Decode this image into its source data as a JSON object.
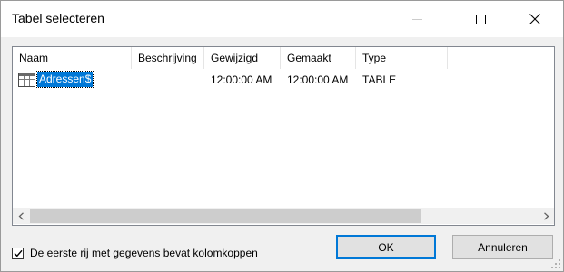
{
  "window": {
    "title": "Tabel selecteren"
  },
  "titlebar_controls": {
    "minimize_icon": "minimize-icon",
    "maximize_icon": "maximize-icon",
    "close_icon": "close-icon"
  },
  "table_list": {
    "columns": [
      "Naam",
      "Beschrijving",
      "Gewijzigd",
      "Gemaakt",
      "Type"
    ],
    "rows": [
      {
        "name": "Adressen$",
        "description": "",
        "modified": "12:00:00 AM",
        "created": "12:00:00 AM",
        "type": "TABLE",
        "icon": "table-icon",
        "selected": true
      }
    ]
  },
  "scrollbar": {
    "left_icon": "scroll-left-icon",
    "right_icon": "scroll-right-icon"
  },
  "options": {
    "first_row_headers_label": "De eerste rij met gegevens bevat kolomkoppen",
    "first_row_headers_checked": true
  },
  "buttons": {
    "ok_label": "OK",
    "cancel_label": "Annuleren"
  },
  "colors": {
    "accent": "#0078d7",
    "dialog_bg": "#f0f0f0",
    "list_bg": "#ffffff"
  }
}
